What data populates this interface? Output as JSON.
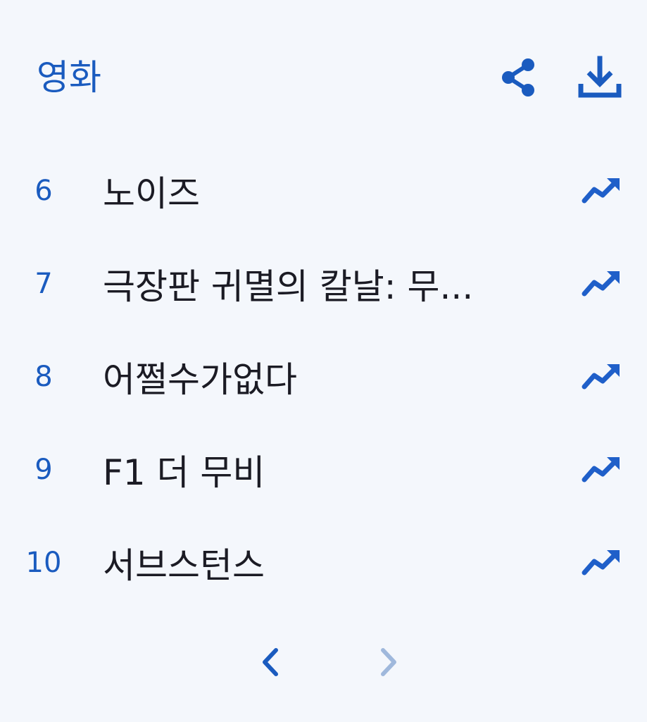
{
  "header": {
    "title": "영화",
    "share_icon": "share-icon",
    "download_icon": "download-icon"
  },
  "colors": {
    "accent": "#1a5bbf",
    "trend": "#1f5fc9",
    "disabled": "#9fb8dc",
    "text": "#1b1b24",
    "background": "#f4f7fc"
  },
  "items": [
    {
      "rank": "6",
      "title": "노이즈",
      "trend_icon": "trending-up-icon"
    },
    {
      "rank": "7",
      "title": "극장판 귀멸의 칼날: 무...",
      "trend_icon": "trending-up-icon"
    },
    {
      "rank": "8",
      "title": "어쩔수가없다",
      "trend_icon": "trending-up-icon"
    },
    {
      "rank": "9",
      "title": "F1 더 무비",
      "trend_icon": "trending-up-icon"
    },
    {
      "rank": "10",
      "title": "서브스턴스",
      "trend_icon": "trending-up-icon"
    }
  ],
  "pagination": {
    "prev_icon": "chevron-left-icon",
    "next_icon": "chevron-right-icon",
    "next_enabled": false
  }
}
